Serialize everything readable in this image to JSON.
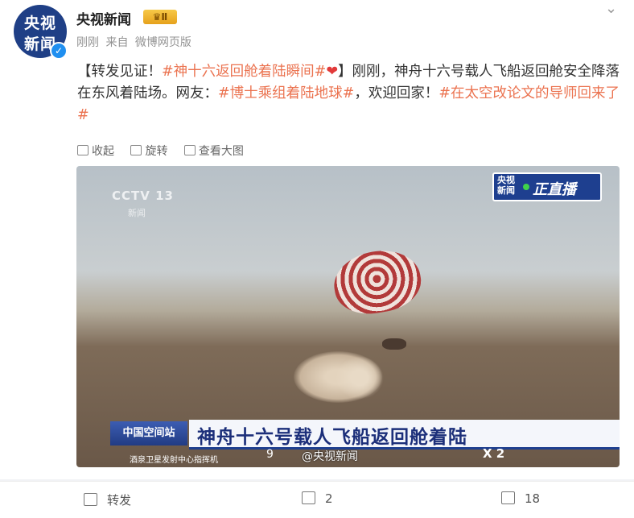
{
  "post": {
    "author": "央视新闻",
    "vip_badge": "Ⅱ",
    "avatar_line1": "央视",
    "avatar_line2": "新闻",
    "time": "刚刚",
    "source_prefix": "来自",
    "source": "微博网页版",
    "text_parts": {
      "p1": "【转发见证！",
      "tag1": "#神十六返回舱着陆瞬间#",
      "heart": "❤",
      "p2": "】刚刚，神舟十六号载人飞船返回舱安全降落在东风着陆场。网友：",
      "tag2": "#博士乘组着陆地球#",
      "p3": "，欢迎回家！",
      "tag3": "#在太空改论文的导师回来了#"
    },
    "media_actions": [
      "收起",
      "旋转",
      "查看大图"
    ]
  },
  "photo": {
    "channel_logo": "CCTV 13",
    "channel_sub": "新闻",
    "live_logo_1": "央视",
    "live_logo_2": "新闻",
    "live_label": "正直播",
    "banner_left": "中国空间站",
    "banner_title": "神舟十六号载人飞船返回舱着陆",
    "subtitle": "酒泉卫星发射中心指挥机",
    "number": "9",
    "watermark": "@央视新闻",
    "zoom": "X 2"
  },
  "footer": {
    "repost_label": "转发",
    "comment_count": "2",
    "like_count": "18"
  }
}
